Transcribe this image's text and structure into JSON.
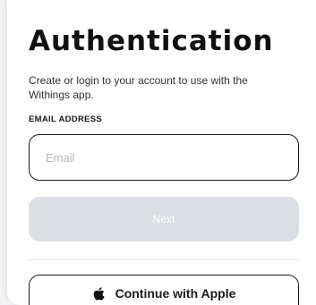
{
  "auth": {
    "title": "Authentication",
    "description": "Create or login to your account to use with the Withings app.",
    "email_label": "EMAIL ADDRESS",
    "email_placeholder": "Email",
    "email_value": "",
    "next_label": "Next",
    "apple_label": "Continue with Apple"
  },
  "icons": {
    "apple": "apple-icon"
  },
  "colors": {
    "next_disabled_bg": "#dcdfe4",
    "border": "#1a1a1a"
  }
}
